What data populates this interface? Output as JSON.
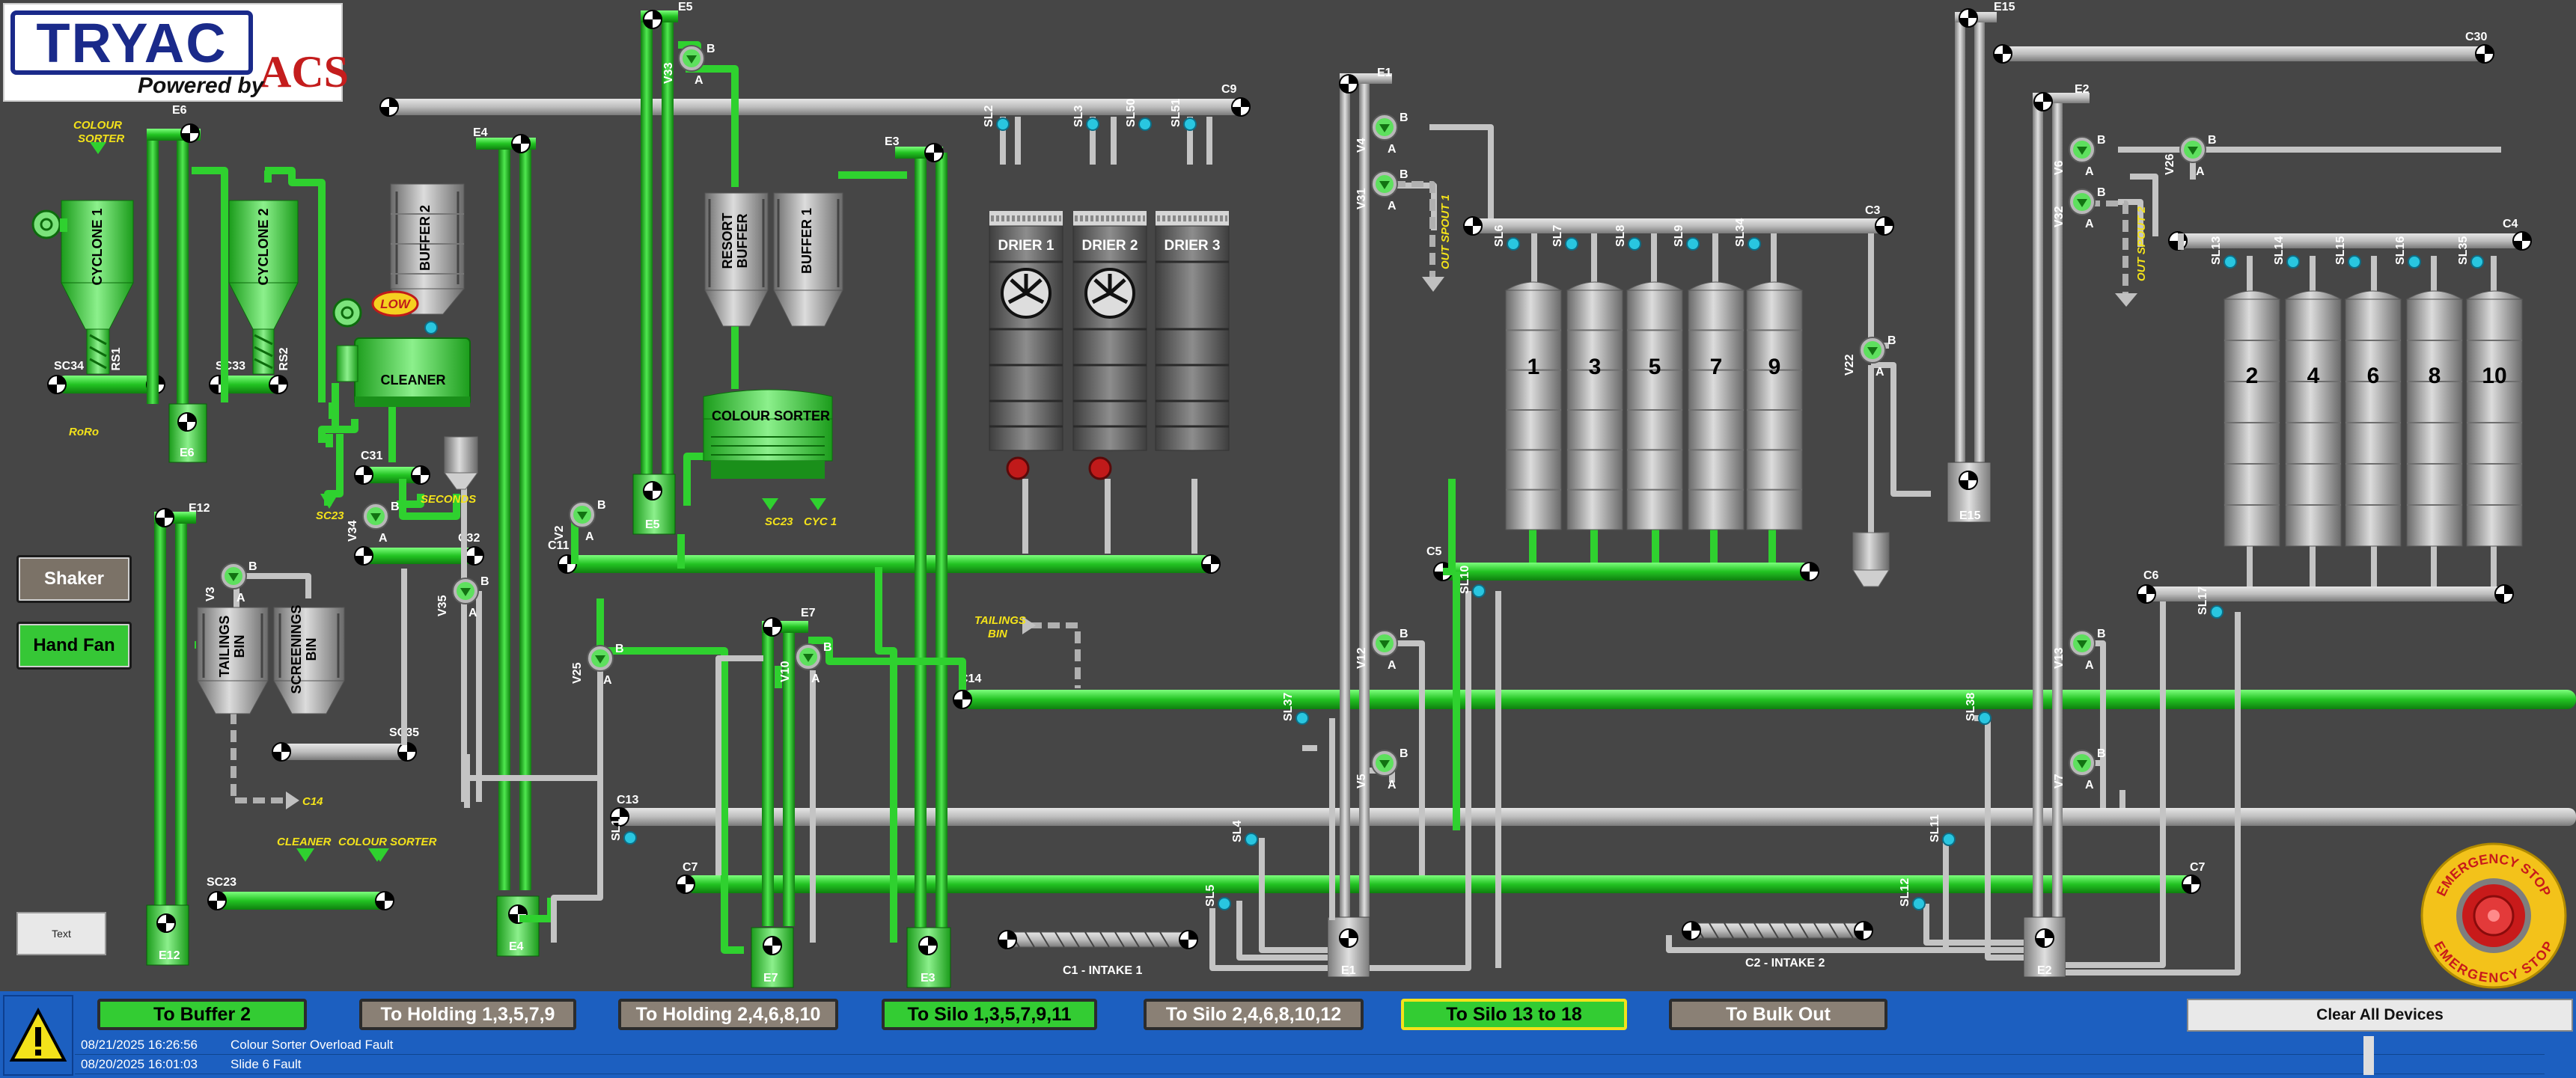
{
  "logo": {
    "brand": "TRYAC",
    "powered": "Powered by",
    "partner": "ACS"
  },
  "colors": {
    "running": "#33cc33",
    "idle": "#b8b8b8",
    "background": "#464646",
    "label": "#f3e21a",
    "sensor": "#29c6e0",
    "alarm_bar": "#1c5fc0"
  },
  "side_buttons": {
    "shaker": "Shaker",
    "hand_fan": "Hand Fan",
    "text": "Text"
  },
  "elevators": {
    "e1": "E1",
    "e2": "E2",
    "e3": "E3",
    "e4": "E4",
    "e5": "E5",
    "e6": "E6",
    "e7": "E7",
    "e12": "E12",
    "e15": "E15"
  },
  "conveyors": {
    "c1": "C1 - INTAKE 1",
    "c2": "C2 - INTAKE 2",
    "c3": "C3",
    "c4": "C4",
    "c5": "C5",
    "c6": "C6",
    "c7": "C7",
    "c9": "C9",
    "c11": "C11",
    "c13": "C13",
    "c14": "C14",
    "c23": "SC23",
    "c30": "C30",
    "c31": "C31",
    "c32": "C32",
    "sc33": "SC33",
    "sc34": "SC34",
    "sc35": "SC35"
  },
  "equipment": {
    "cyclone1": "CYCLONE 1",
    "cyclone2": "CYCLONE 2",
    "rs1": "RS1",
    "rs2": "RS2",
    "roro": "RoRo",
    "colour_sorter_top": "COLOUR\nSORTER",
    "buffer2_left": "BUFFER 2",
    "cleaner": "CLEANER",
    "low": "LOW",
    "sl49": "SL49",
    "seconds": "SECONDS",
    "sc23_a": "SC23",
    "resort_buffer": "RESORT BUFFER",
    "buffer1": "BUFFER 1",
    "colour_sorter": "COLOUR SORTER",
    "sc23_b": "SC23",
    "cyc1": "CYC 1",
    "drier1": "DRIER 1",
    "drier2": "DRIER 2",
    "drier3": "DRIER 3",
    "tailings_bin": "TAILINGS BIN",
    "screenings_bin": "SCREENINGS BIN",
    "tailings_bin_label": "TAILINGS\nBIN",
    "c14_tag": "C14",
    "cleaner_tag": "CLEANER",
    "colour_sorter_tag": "COLOUR SORTER",
    "out_spout1": "OUT SPOUT 1",
    "out_spout2": "OUT SPOUT 2"
  },
  "silos_odd": [
    "1",
    "3",
    "5",
    "7",
    "9"
  ],
  "silos_even": [
    "2",
    "4",
    "6",
    "8",
    "10"
  ],
  "valves": {
    "v2": "V2",
    "v3": "V3",
    "v4": "V4",
    "v5": "V5",
    "v6": "V6",
    "v7": "V7",
    "v10": "V10",
    "v12": "V12",
    "v13": "V13",
    "v22": "V22",
    "v25": "V25",
    "v26": "V26",
    "v31": "V31",
    "v32": "V32",
    "v33": "V33",
    "v34": "V34",
    "v35": "V35",
    "a": "A",
    "b": "B"
  },
  "sensors": {
    "sl1": "SL1",
    "sl2": "SL2",
    "sl3": "SL3",
    "sl4": "SL4",
    "sl5": "SL5",
    "sl6": "SL6",
    "sl7": "SL7",
    "sl8": "SL8",
    "sl9": "SL9",
    "sl10": "SL10",
    "sl11": "SL11",
    "sl12": "SL12",
    "sl13": "SL13",
    "sl14": "SL14",
    "sl15": "SL15",
    "sl16": "SL16",
    "sl17": "SL17",
    "sl34": "SL34",
    "sl35": "SL35",
    "sl37": "SL37",
    "sl38": "SL38",
    "sl50": "SL50",
    "sl51": "SL51"
  },
  "routes": [
    {
      "label": "To Buffer 2",
      "state": "on"
    },
    {
      "label": "To Holding 1,3,5,7,9",
      "state": "off"
    },
    {
      "label": "To Holding 2,4,6,8,10",
      "state": "off"
    },
    {
      "label": "To Silo 1,3,5,7,9,11",
      "state": "on"
    },
    {
      "label": "To Silo 2,4,6,8,10,12",
      "state": "off"
    },
    {
      "label": "To Silo 13 to 18",
      "state": "selected"
    },
    {
      "label": "To Bulk Out",
      "state": "off"
    }
  ],
  "clear_all": "Clear All Devices",
  "alarms": [
    {
      "time": "08/21/2025 16:26:56",
      "message": "Colour Sorter Overload Fault"
    },
    {
      "time": "08/20/2025 16:01:03",
      "message": "Slide 6 Fault"
    }
  ],
  "estop": {
    "top": "EMERGENCY STOP",
    "bottom": "EMERGENCY STOP"
  }
}
